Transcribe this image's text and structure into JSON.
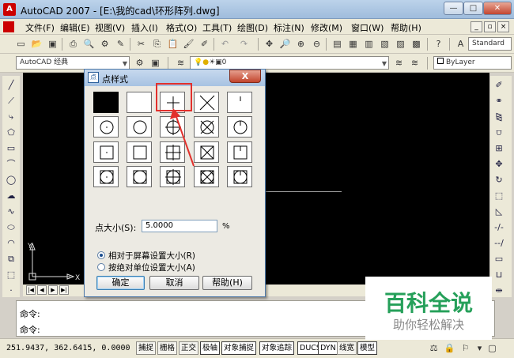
{
  "window": {
    "title": "AutoCAD 2007 - [E:\\我的cad\\环形阵列.dwg]",
    "app_icon": "A",
    "min": "—",
    "max": "□",
    "close": "✕"
  },
  "menu": [
    "文件(F)",
    "编辑(E)",
    "视图(V)",
    "插入(I)",
    "格式(O)",
    "工具(T)",
    "绘图(D)",
    "标注(N)",
    "修改(M)",
    "窗口(W)",
    "帮助(H)"
  ],
  "toolbar": {
    "workspace": "AutoCAD 经典",
    "layer_value": "0",
    "text_style": "Standard",
    "bylayer": "ByLayer"
  },
  "drawing": {
    "ucs_x": "X",
    "ucs_y": "Y"
  },
  "command": {
    "line1": "命令:",
    "line2": "命令:"
  },
  "status": {
    "coords": "251.9437, 362.6415, 0.0000",
    "buttons": [
      "捕捉",
      "栅格",
      "正交",
      "极轴",
      "对象捕捉",
      "对象追踪",
      "DUCS",
      "DYN",
      "线宽",
      "模型"
    ],
    "active": [
      "极轴",
      "对象捕捉",
      "对象追踪",
      "DUCS",
      "DYN",
      "模型"
    ]
  },
  "dialog": {
    "title": "点样式",
    "icon": "点",
    "close": "X",
    "point_styles": [
      [
        "dot",
        "blank",
        "plus",
        "x",
        "tick"
      ],
      [
        "circle-dot",
        "circle",
        "circle-plus",
        "circle-x",
        "circle-tick"
      ],
      [
        "square-dot",
        "square",
        "square-plus",
        "square-x",
        "square-tick"
      ],
      [
        "cs-dot",
        "cs",
        "cs-plus",
        "cs-x",
        "cs-tick"
      ]
    ],
    "selected": {
      "row": 0,
      "col": 0
    },
    "size_label": "点大小(S):",
    "size_value": "5.0000",
    "size_unit": "%",
    "radio1": "相对于屏幕设置大小(R)",
    "radio2": "按绝对单位设置大小(A)",
    "radio_selected": 1,
    "ok": "确定",
    "cancel": "取消",
    "help": "帮助(H)"
  },
  "watermark": {
    "title": "百科全说",
    "subtitle": "助你轻松解决"
  },
  "colors": {
    "drawing_bg": "#000000",
    "highlight": "#e2302c",
    "watermark": "#26a05a"
  }
}
